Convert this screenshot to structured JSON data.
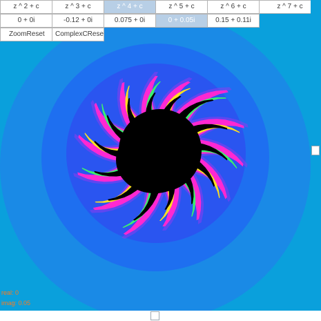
{
  "power_buttons": [
    {
      "label": "z ^ 2 + c",
      "selected": false
    },
    {
      "label": "z ^ 3 + c",
      "selected": false
    },
    {
      "label": "z ^ 4 + c",
      "selected": true
    },
    {
      "label": "z ^ 5 + c",
      "selected": false
    },
    {
      "label": "z ^ 6 + c",
      "selected": false
    },
    {
      "label": "z ^ 7 + c",
      "selected": false
    }
  ],
  "complex_buttons": [
    {
      "label": "0 + 0i",
      "selected": false
    },
    {
      "label": "-0.12 + 0i",
      "selected": false
    },
    {
      "label": "0.075 + 0i",
      "selected": false
    },
    {
      "label": "0 + 0.05i",
      "selected": true
    },
    {
      "label": "0.15 + 0.11i",
      "selected": false
    }
  ],
  "controls": {
    "zoom_reset_label": "ZoomReset",
    "complex_reset_label": "ComplexCReset"
  },
  "status": {
    "real_text": "real: 0",
    "imag_text": "imag: 0.05"
  },
  "fractal": {
    "formula": "z ^ 4 + c",
    "c_real": 0,
    "c_imag": 0.05,
    "colors": {
      "outer_background": "#0aa0dc",
      "band_1": "#1a8ae6",
      "band_2": "#1e6ff0",
      "band_3": "#2a55f0",
      "glow": "#8a3cf0",
      "spike_magenta": "#ff28d2",
      "spike_green": "#3cf06e",
      "spike_yellow": "#ffe020",
      "interior": "#000000"
    }
  }
}
